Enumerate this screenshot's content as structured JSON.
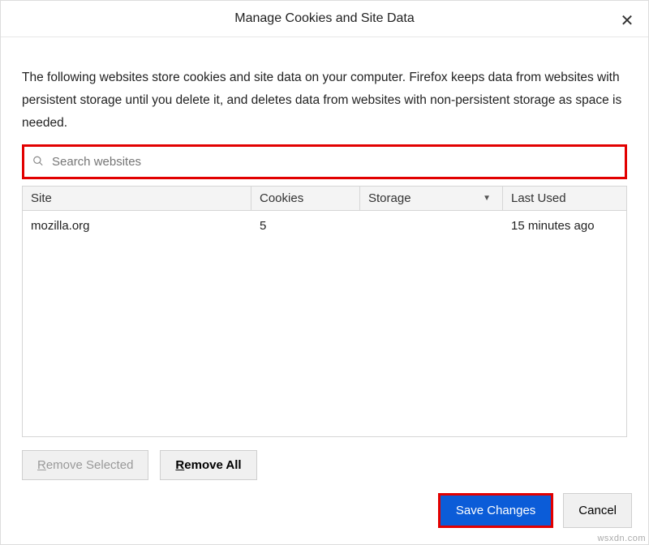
{
  "titlebar": {
    "title": "Manage Cookies and Site Data"
  },
  "description": "The following websites store cookies and site data on your computer. Firefox keeps data from websites with persistent storage until you delete it, and deletes data from websites with non-persistent storage as space is needed.",
  "search": {
    "placeholder": "Search websites",
    "value": ""
  },
  "columns": {
    "site": "Site",
    "cookies": "Cookies",
    "storage": "Storage",
    "last_used": "Last Used"
  },
  "rows": [
    {
      "site": "mozilla.org",
      "cookies": "5",
      "storage": "",
      "last_used": "15 minutes ago"
    }
  ],
  "buttons": {
    "remove_selected_pre": "R",
    "remove_selected_rest": "emove Selected",
    "remove_all_pre": "R",
    "remove_all_rest": "emove All",
    "save": "Save Changes",
    "cancel": "Cancel"
  },
  "watermark": "wsxdn.com"
}
